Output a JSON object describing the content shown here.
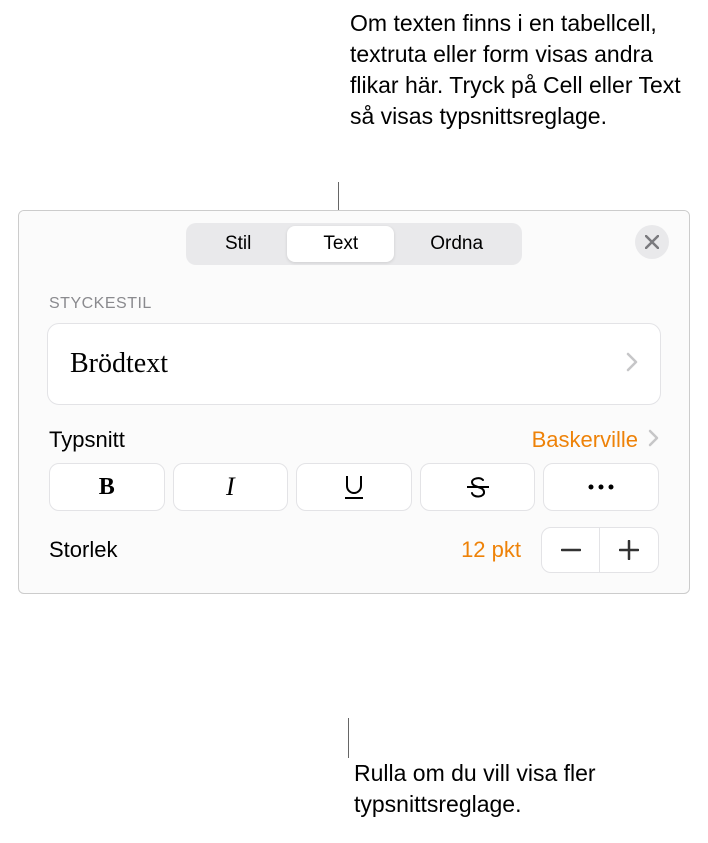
{
  "callouts": {
    "top": "Om texten finns i en tabellcell, textruta eller form visas andra flikar här. Tryck på Cell eller Text så visas typsnittsreglage.",
    "bottom": "Rulla om du vill visa fler typsnittsreglage."
  },
  "tabs": {
    "style": "Stil",
    "text": "Text",
    "arrange": "Ordna"
  },
  "paragraph_style": {
    "label": "STYCKESTIL",
    "value": "Brödtext"
  },
  "font": {
    "label": "Typsnitt",
    "value": "Baskerville"
  },
  "size": {
    "label": "Storlek",
    "value": "12 pkt"
  }
}
